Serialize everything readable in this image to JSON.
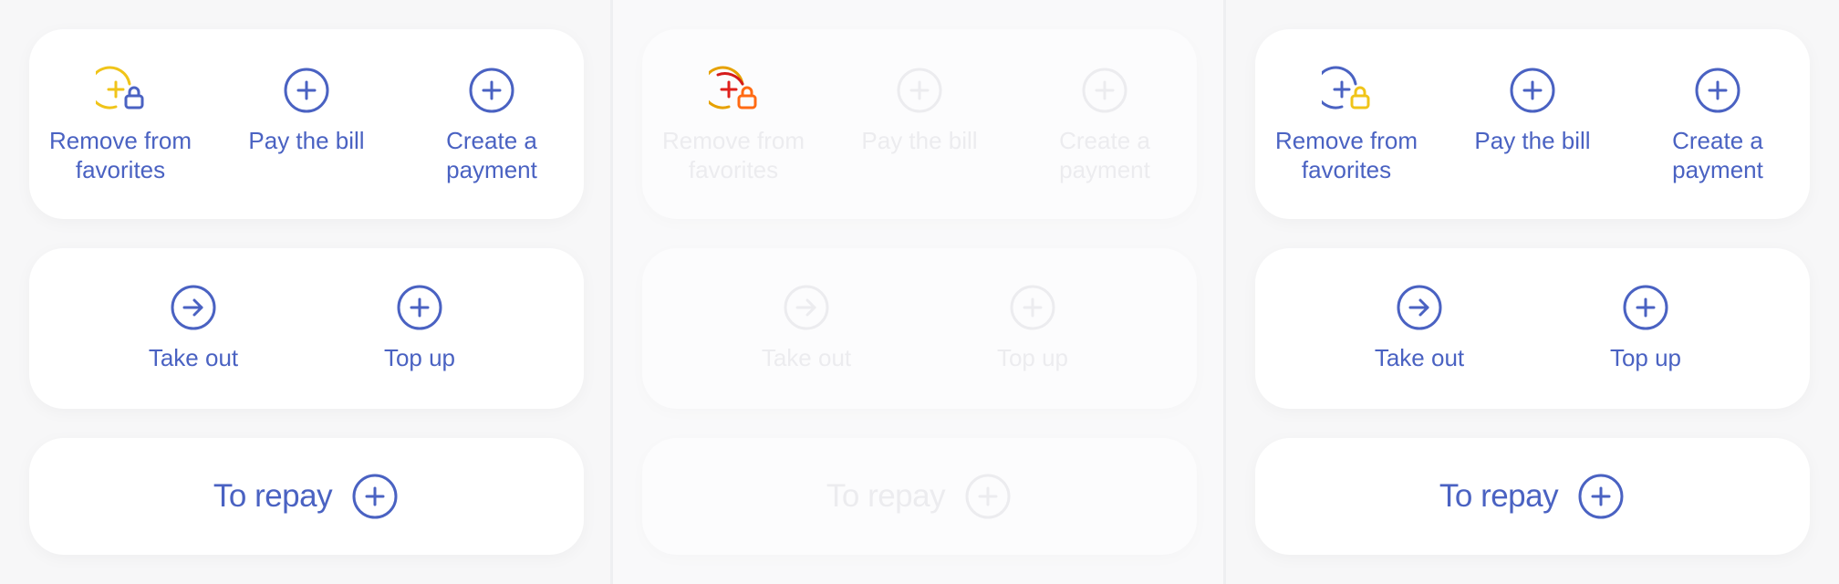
{
  "colors": {
    "accent": "#4a62c2",
    "lock_warning": "#f0c419",
    "lock_error_ring": "#e6a100",
    "lock_error_plus": "#e0201b",
    "lock_error_lock": "#ff6a13",
    "disabled": "#ececef"
  },
  "icons": {
    "favorite": "plus-circle-with-lock-icon",
    "pay": "plus-circle-icon",
    "create": "plus-circle-icon",
    "take_out": "arrow-right-circle-icon",
    "top_up": "plus-circle-icon",
    "repay": "plus-circle-icon"
  },
  "panels": [
    {
      "state": "default",
      "remove_favorites": "Remove from\nfavorites",
      "pay_bill": "Pay the bill",
      "create_payment": "Create a\npayment",
      "take_out": "Take out",
      "top_up": "Top up",
      "repay": "To repay"
    },
    {
      "state": "disabled",
      "remove_favorites": "Remove from\nfavorites",
      "pay_bill": "Pay the bill",
      "create_payment": "Create a\npayment",
      "take_out": "Take out",
      "top_up": "Top up",
      "repay": "To repay"
    },
    {
      "state": "locked",
      "remove_favorites": "Remove from\nfavorites",
      "pay_bill": "Pay the bill",
      "create_payment": "Create a\npayment",
      "take_out": "Take out",
      "top_up": "Top up",
      "repay": "To repay"
    }
  ]
}
